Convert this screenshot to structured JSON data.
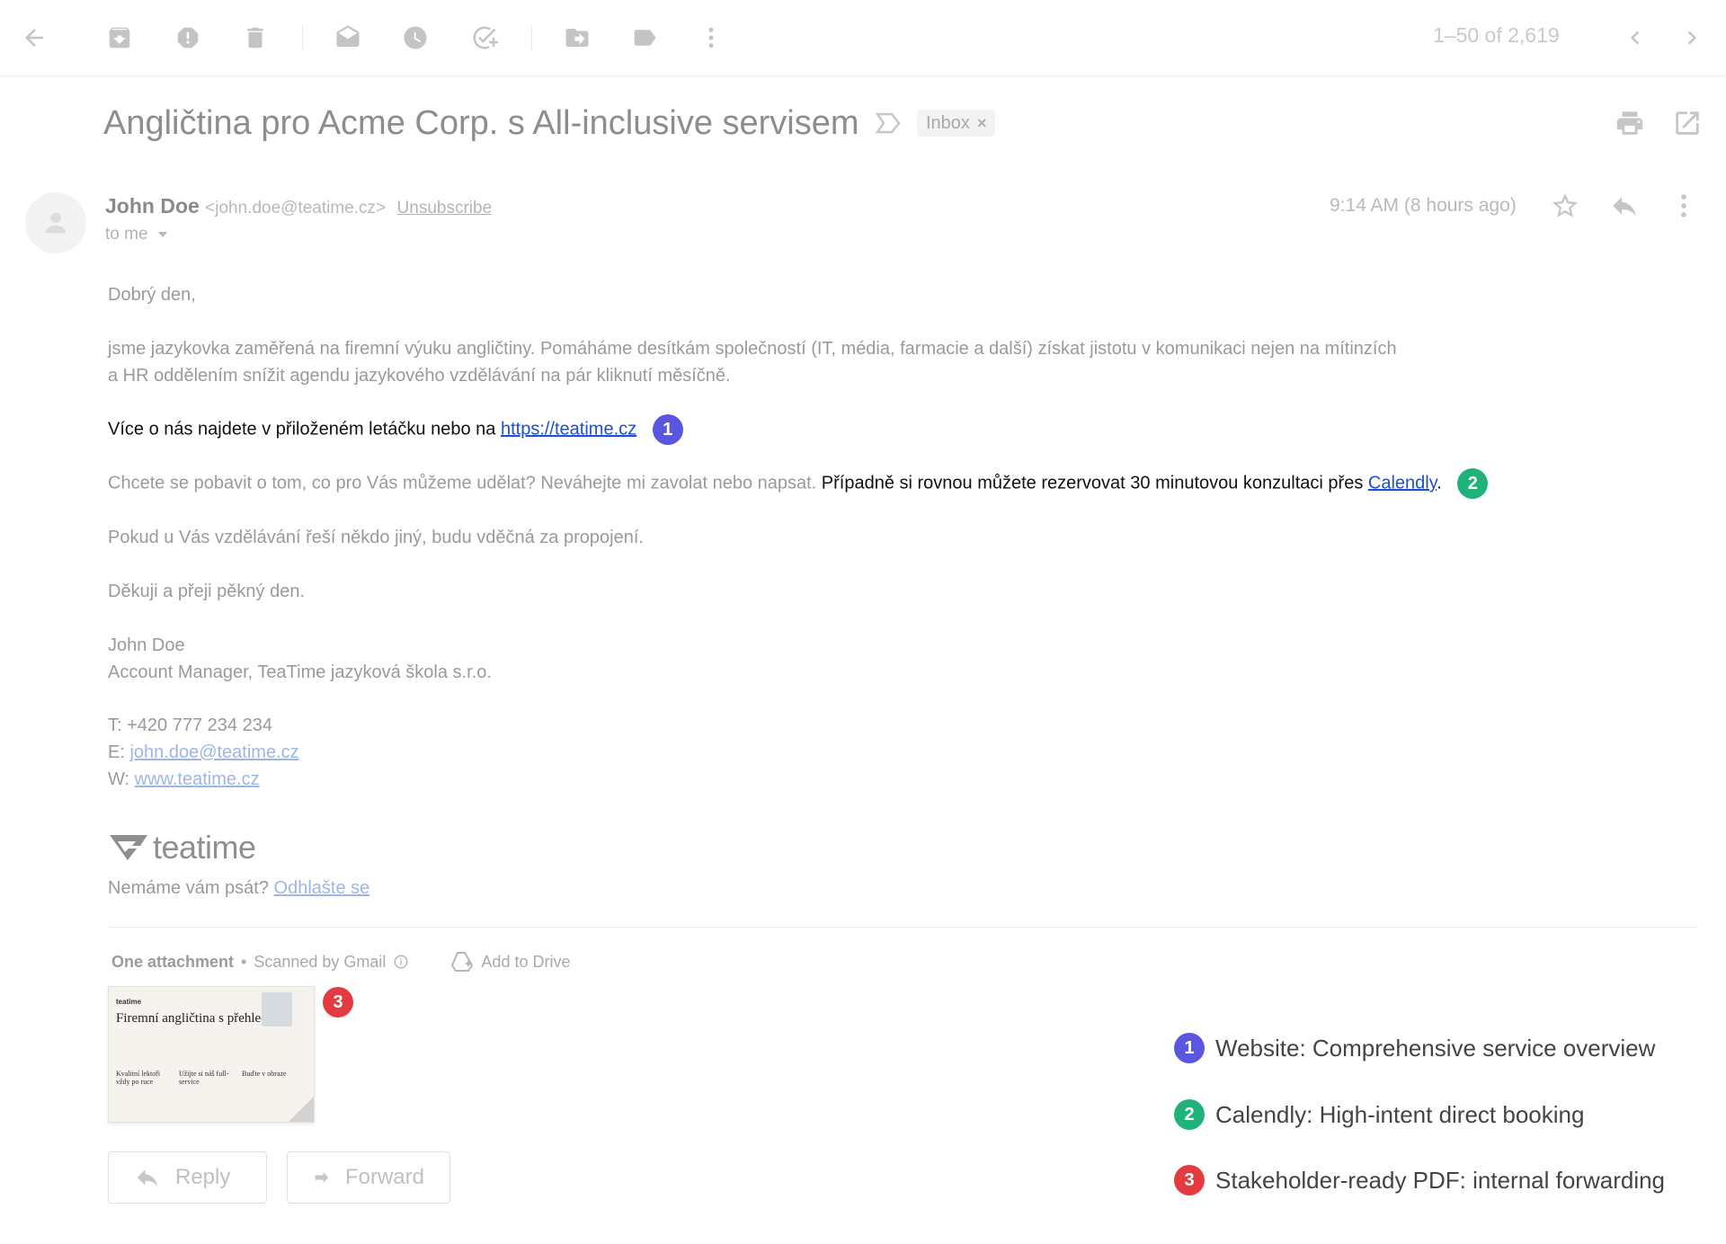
{
  "toolbar": {
    "icons": [
      "back-arrow-icon",
      "archive-icon",
      "report-spam-icon",
      "delete-icon",
      "mark-unread-icon",
      "snooze-icon",
      "add-to-tasks-icon",
      "move-to-icon",
      "labels-icon",
      "more-vert-icon"
    ],
    "pager_text": "1–50 of 2,619"
  },
  "email": {
    "subject": "Angličtina pro Acme Corp. s All-inclusive servisem",
    "label": "Inbox",
    "label_close": "×",
    "sender_name": "John Doe",
    "sender_email": "<john.doe@teatime.cz>",
    "unsubscribe": "Unsubscribe",
    "to": "to me",
    "time": "9:14 AM  (8 hours ago)"
  },
  "body": {
    "greeting": "Dobrý den,",
    "p1_line1": "jsme jazykovka zaměřená na firemní výuku angličtiny. Pomáháme desítkám společností (IT, média, farmacie a další) získat jistotu v komunikaci nejen na mítinzích",
    "p1_line2": "a HR oddělením snížit agendu jazykového vzdělávání na pár kliknutí měsíčně.",
    "p2_text": "Více o nás najdete v přiloženém letáčku nebo na ",
    "p2_link": "https://teatime.cz",
    "p3_text": "Chcete se pobavit o tom, co pro Vás můžeme udělat? Neváhejte mi zavolat nebo napsat. ",
    "p3_dark": "Případně si rovnou můžete rezervovat 30 minutovou konzultaci přes ",
    "p3_link": "Calendly",
    "p3_end": ".",
    "p4": "Pokud u Vás vzdělávání řeší někdo jiný, budu vděčná za propojení.",
    "p5": "Děkuji a přeji pěkný den.",
    "sig_name": "John Doe",
    "sig_title": "Account Manager, TeaTime jazyková škola s.r.o.",
    "sig_phone": "T: +420 777 234 234",
    "sig_email_label": "E: ",
    "sig_email": "john.doe@teatime.cz",
    "sig_web_label": "W: ",
    "sig_web": "www.teatime.cz",
    "logo_text": "teatime",
    "optout_text": "Nemáme vám psát? ",
    "optout_link": "Odhlašte se"
  },
  "attachment": {
    "count_label": "One attachment",
    "dot": "•",
    "scanned": "Scanned by Gmail",
    "add_drive": "Add to Drive",
    "thumb_logo": "teatime",
    "thumb_title": "Firemní angličtina s přehledem",
    "thumb_col1": "Kvalitní lektoři vždy po ruce",
    "thumb_col2": "Užijte si náš full-service",
    "thumb_col3": "Buďte v obraze"
  },
  "actions": {
    "reply": "Reply",
    "forward": "Forward"
  },
  "markers": {
    "one": "1",
    "two": "2",
    "three": "3"
  },
  "legend": [
    {
      "num": "1",
      "text": "Website: Comprehensive service overview",
      "color": "#5b56e0"
    },
    {
      "num": "2",
      "text": "Calendly: High-intent direct booking",
      "color": "#1fb37a"
    },
    {
      "num": "3",
      "text": "Stakeholder-ready PDF: internal forwarding",
      "color": "#e33b3f"
    }
  ]
}
